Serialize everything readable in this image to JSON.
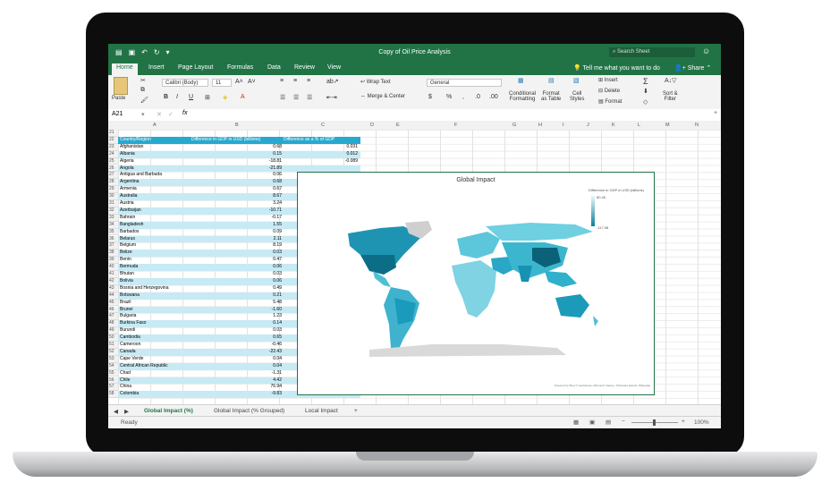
{
  "window": {
    "title": "Copy of Oil Price Analysis",
    "search_placeholder": "Search Sheet"
  },
  "ribbon_tabs": [
    "Home",
    "Insert",
    "Page Layout",
    "Formulas",
    "Data",
    "Review",
    "View"
  ],
  "tell_me": "Tell me what you want to do",
  "share_label": "Share",
  "ribbon": {
    "paste": "Paste",
    "font_name": "Calibri (Body)",
    "font_size": "11",
    "wrap_text": "Wrap Text",
    "merge_center": "Merge & Center",
    "number_format": "General",
    "conditional_formatting": [
      "Conditional",
      "Formatting"
    ],
    "format_as_table": [
      "Format",
      "as Table"
    ],
    "cell_styles": [
      "Cell",
      "Styles"
    ],
    "insert": "Insert",
    "delete": "Delete",
    "format": "Format",
    "sort_filter": [
      "Sort &",
      "Filter"
    ]
  },
  "formula_bar": {
    "name_box": "A21",
    "fx": "fx"
  },
  "columns": [
    "A",
    "B",
    "C",
    "D",
    "E",
    "F",
    "G",
    "H",
    "I",
    "J",
    "K",
    "L",
    "M",
    "N"
  ],
  "table": {
    "headers": [
      "Country/Region",
      "Difference in GDP in USD (billions)",
      "Difference as a % of GDP"
    ],
    "rows": [
      {
        "n": "23",
        "country": "Afghanistan",
        "gdp": "0.68",
        "pct": "0.031"
      },
      {
        "n": "24",
        "country": "Albania",
        "gdp": "0.15",
        "pct": "0.012"
      },
      {
        "n": "25",
        "country": "Algeria",
        "gdp": "-18.81",
        "pct": "-0.089"
      },
      {
        "n": "26",
        "country": "Angola",
        "gdp": "-21.89",
        "pct": ""
      },
      {
        "n": "27",
        "country": "Antigua and Barbuda",
        "gdp": "0.06",
        "pct": ""
      },
      {
        "n": "28",
        "country": "Argentina",
        "gdp": "0.68",
        "pct": ""
      },
      {
        "n": "29",
        "country": "Armenia",
        "gdp": "0.67",
        "pct": ""
      },
      {
        "n": "30",
        "country": "Australia",
        "gdp": "8.67",
        "pct": ""
      },
      {
        "n": "31",
        "country": "Austria",
        "gdp": "3.24",
        "pct": ""
      },
      {
        "n": "32",
        "country": "Azerbaijan",
        "gdp": "-10.71",
        "pct": ""
      },
      {
        "n": "33",
        "country": "Bahrain",
        "gdp": "-0.17",
        "pct": ""
      },
      {
        "n": "34",
        "country": "Bangladesh",
        "gdp": "1.55",
        "pct": ""
      },
      {
        "n": "35",
        "country": "Barbados",
        "gdp": "0.09",
        "pct": ""
      },
      {
        "n": "36",
        "country": "Belarus",
        "gdp": "2.11",
        "pct": ""
      },
      {
        "n": "37",
        "country": "Belgium",
        "gdp": "8.19",
        "pct": ""
      },
      {
        "n": "38",
        "country": "Belize",
        "gdp": "0.03",
        "pct": ""
      },
      {
        "n": "39",
        "country": "Benin",
        "gdp": "0.47",
        "pct": ""
      },
      {
        "n": "40",
        "country": "Bermuda",
        "gdp": "0.06",
        "pct": ""
      },
      {
        "n": "41",
        "country": "Bhutan",
        "gdp": "0.03",
        "pct": ""
      },
      {
        "n": "42",
        "country": "Bolivia",
        "gdp": "0.06",
        "pct": ""
      },
      {
        "n": "43",
        "country": "Bosnia and Herzegovina",
        "gdp": "0.49",
        "pct": ""
      },
      {
        "n": "44",
        "country": "Botswana",
        "gdp": "0.21",
        "pct": ""
      },
      {
        "n": "45",
        "country": "Brazil",
        "gdp": "5.48",
        "pct": ""
      },
      {
        "n": "46",
        "country": "Brunei",
        "gdp": "-1.60",
        "pct": ""
      },
      {
        "n": "47",
        "country": "Bulgaria",
        "gdp": "1.23",
        "pct": ""
      },
      {
        "n": "48",
        "country": "Burkina Faso",
        "gdp": "0.14",
        "pct": ""
      },
      {
        "n": "49",
        "country": "Burundi",
        "gdp": "0.03",
        "pct": ""
      },
      {
        "n": "50",
        "country": "Cambodia",
        "gdp": "0.65",
        "pct": ""
      },
      {
        "n": "51",
        "country": "Cameroon",
        "gdp": "-0.46",
        "pct": ""
      },
      {
        "n": "52",
        "country": "Canada",
        "gdp": "-22.43",
        "pct": ""
      },
      {
        "n": "53",
        "country": "Cape Verde",
        "gdp": "0.04",
        "pct": ""
      },
      {
        "n": "54",
        "country": "Central African Republic",
        "gdp": "0.04",
        "pct": ""
      },
      {
        "n": "55",
        "country": "Chad",
        "gdp": "-1.31",
        "pct": ""
      },
      {
        "n": "56",
        "country": "Chile",
        "gdp": "4.42",
        "pct": ""
      },
      {
        "n": "57",
        "country": "China",
        "gdp": "76.94",
        "pct": ""
      },
      {
        "n": "58",
        "country": "Colombia",
        "gdp": "-9.83",
        "pct": "-0.026"
      }
    ]
  },
  "chart": {
    "title": "Global Impact",
    "legend_title": "Difference in GDP in USD (billions)",
    "legend_max": "80.45",
    "legend_min": "-117.98",
    "credit": "Powered by Bing © GeoNames, Microsoft, Navteq, Thinkware Extract, Wikipedia"
  },
  "sheet_tabs": [
    "Global Impact (%)",
    "Global Impact (% Grouped)",
    "Local Impact"
  ],
  "add_sheet": "+",
  "status": {
    "ready": "Ready",
    "zoom": "100%"
  },
  "colors": {
    "excel_green": "#217346",
    "table_header": "#27a9cf",
    "band": "#c7eaf4"
  }
}
